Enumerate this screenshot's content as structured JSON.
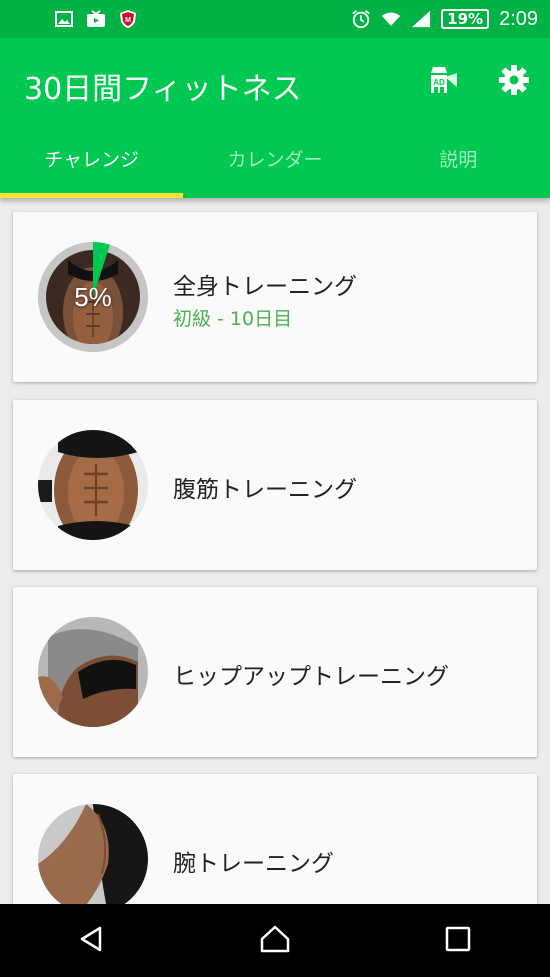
{
  "status_bar": {
    "left_icons": [
      "image-icon",
      "tv-icon",
      "mcafee-icon"
    ],
    "right_icons": [
      "alarm-icon",
      "wifi-icon",
      "signal-icon"
    ],
    "battery": "19%",
    "time": "2:09"
  },
  "app_bar": {
    "title": "30日間フィットネス",
    "actions": [
      "ad-remove-icon",
      "gear-icon"
    ],
    "tabs": [
      {
        "label": "チャレンジ",
        "active": true
      },
      {
        "label": "カレンダー",
        "active": false
      },
      {
        "label": "説明",
        "active": false
      }
    ]
  },
  "workouts": [
    {
      "title": "全身トレーニング",
      "subtitle": "初級 - 10日目",
      "progress_label": "5%",
      "progress_fraction": 0.05
    },
    {
      "title": "腹筋トレーニング"
    },
    {
      "title": "ヒップアップトレーニング"
    },
    {
      "title": "腕トレーニング"
    }
  ],
  "nav_bar": {
    "buttons": [
      "back-icon",
      "home-icon",
      "recents-icon"
    ]
  },
  "colors": {
    "primary": "#00c851",
    "status_bar": "#00b344",
    "tab_indicator": "#ffe135",
    "subtitle_green": "#4caf50"
  }
}
